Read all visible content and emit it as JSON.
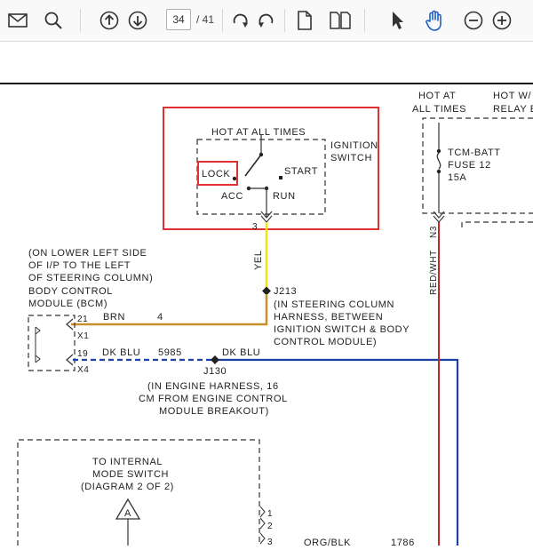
{
  "toolbar": {
    "page_number": "34",
    "page_total": "/ 41",
    "icons": [
      "mail-icon",
      "search-icon",
      "arrow-up-icon",
      "arrow-down-icon",
      "rotate-cw-icon",
      "rotate-ccw-icon",
      "single-page-icon",
      "two-page-icon",
      "pointer-icon",
      "hand-icon",
      "zoom-out-icon",
      "zoom-in-icon"
    ]
  },
  "colors": {
    "highlight": "#e03030",
    "yel": "#f5e21a",
    "brn": "#c8902a",
    "dk_blu": "#1a3fa6",
    "red_wht": "#c0282a"
  },
  "diagram": {
    "hot_at_all_times_top": "HOT AT ALL TIMES",
    "ignition_switch_1": "IGNITION",
    "ignition_switch_2": "SWITCH",
    "lock": "LOCK",
    "start": "START",
    "acc": "ACC",
    "run": "RUN",
    "pin3": "3",
    "yel": "YEL",
    "j213": "J213",
    "j213_note_1": "(IN STEERING COLUMN",
    "j213_note_2": "HARNESS, BETWEEN",
    "j213_note_3": "IGNITION SWITCH & BODY",
    "j213_note_4": "CONTROL MODULE)",
    "bcm_1": "(ON LOWER LEFT SIDE",
    "bcm_2": "OF I/P TO THE LEFT",
    "bcm_3": "OF STEERING COLUMN)",
    "bcm_4": "BODY CONTROL",
    "bcm_5": "MODULE (BCM)",
    "pin21": "21",
    "x1": "X1",
    "brn": "BRN",
    "circuit4": "4",
    "pin19": "19",
    "x4": "X4",
    "dk_blu_1": "DK BLU",
    "circuit5985": "5985",
    "dk_blu_2": "DK BLU",
    "j130": "J130",
    "j130_note_1": "(IN ENGINE HARNESS, 16",
    "j130_note_2": "CM FROM ENGINE CONTROL",
    "j130_note_3": "MODULE BREAKOUT)",
    "hot_at_1": "HOT AT",
    "hot_at_2": "ALL TIMES",
    "hot_w_1": "HOT W/",
    "hot_w_2": "RELAY E",
    "fuse_1": "TCM-BATT",
    "fuse_2": "FUSE 12",
    "fuse_3": "15A",
    "n3": "N3",
    "red_wht": "RED/WHT",
    "internal_1": "TO INTERNAL",
    "internal_2": "MODE SWITCH",
    "internal_3": "(DIAGRAM 2 OF 2)",
    "triangle_a": "A",
    "pin1": "1",
    "pin2": "2",
    "pin3b": "3",
    "org_blk": "ORG/BLK",
    "circuit1786": "1786"
  }
}
